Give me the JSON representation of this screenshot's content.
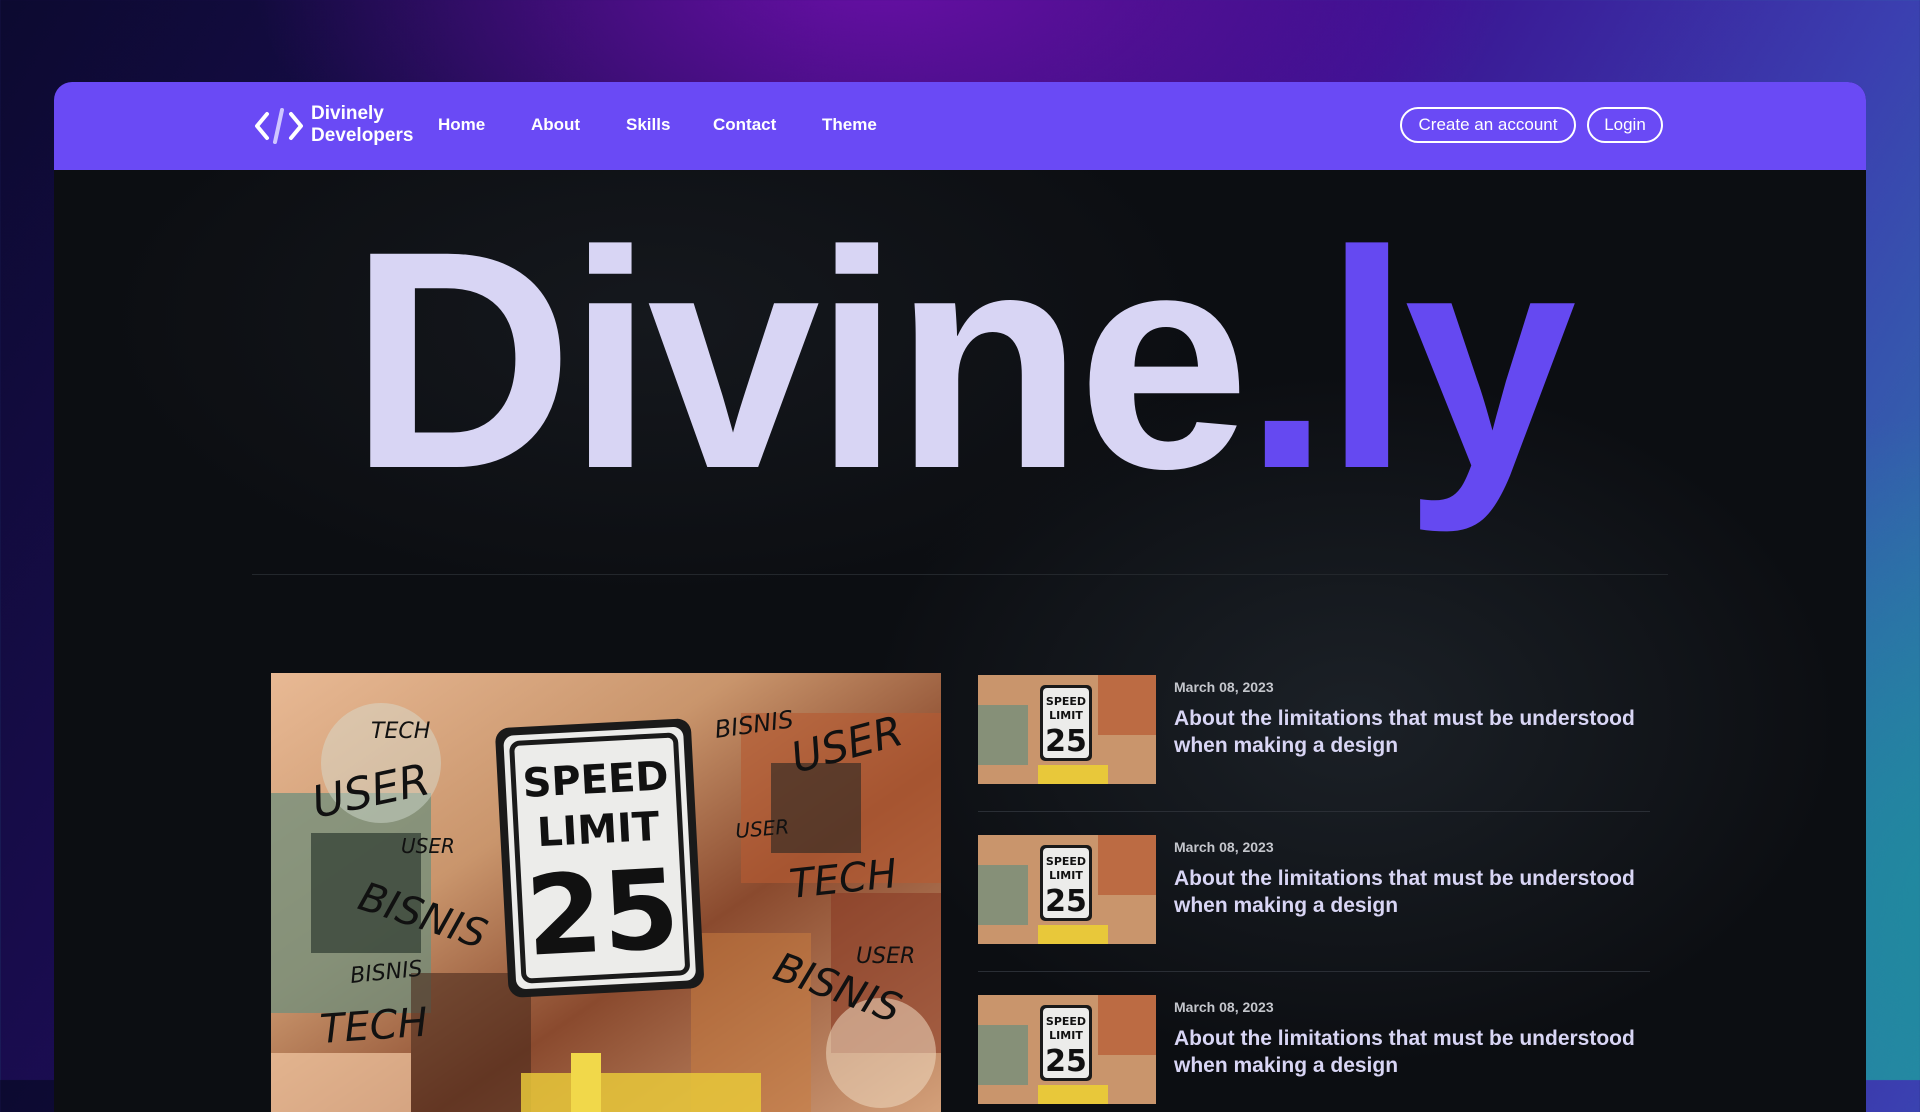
{
  "brand": {
    "line1": "Divinely",
    "line2": "Developers",
    "icon": "code-brackets-icon"
  },
  "nav": {
    "links": [
      {
        "label": "Home"
      },
      {
        "label": "About"
      },
      {
        "label": "Skills"
      },
      {
        "label": "Contact"
      },
      {
        "label": "Theme"
      }
    ],
    "create_account": "Create an account",
    "login": "Login"
  },
  "hero": {
    "main": "Divine",
    "dot": ".",
    "accent": "ly"
  },
  "featured_image": {
    "sign_line1": "SPEED",
    "sign_line2": "LIMIT",
    "sign_number": "25",
    "graffiti": [
      "TECH",
      "USER",
      "USER",
      "BISNIS",
      "BISNIS",
      "TECH",
      "BISNIS",
      "USER",
      "TECH",
      "USER",
      "BISNIS",
      "USER"
    ]
  },
  "posts": [
    {
      "date": "March 08, 2023",
      "title": "About the limitations that must be understood when making a design"
    },
    {
      "date": "March 08, 2023",
      "title": "About the limitations that must be understood when making a design"
    },
    {
      "date": "March 08, 2023",
      "title": "About the limitations that must be understood when making a design"
    }
  ],
  "colors": {
    "nav_bg": "#6a4af5",
    "accent": "#6549f1",
    "hero_text": "#d8d5f4",
    "page_bg": "#0c0e12"
  }
}
